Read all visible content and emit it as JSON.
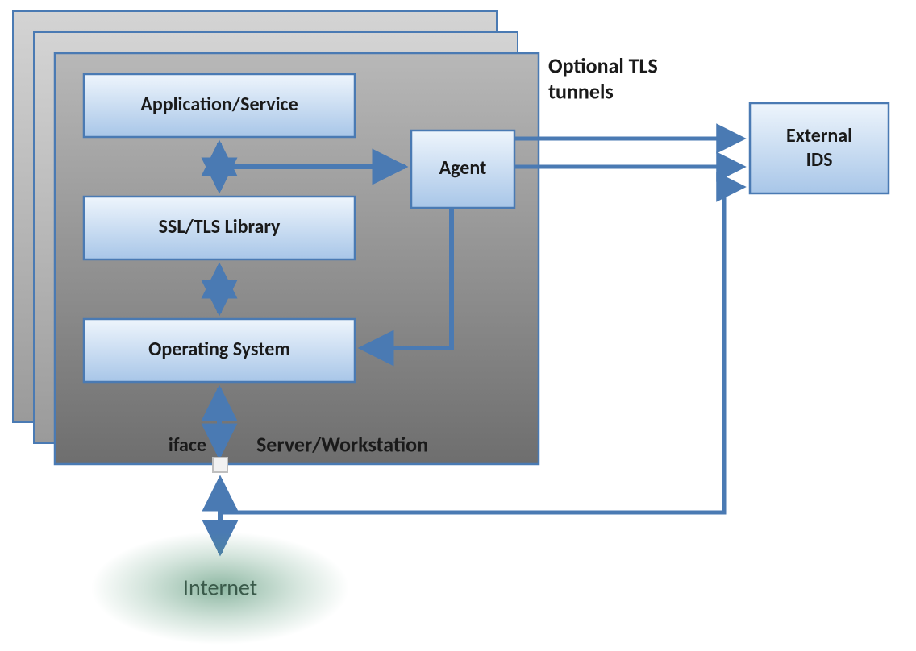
{
  "boxes": {
    "application": "Application/Service",
    "ssltls": "SSL/TLS Library",
    "os": "Operating System",
    "agent": "Agent",
    "external_ids_l1": "External",
    "external_ids_l2": "IDS"
  },
  "labels": {
    "optional_l1": "Optional TLS",
    "optional_l2": "tunnels",
    "server_workstation": "Server/Workstation",
    "iface": "iface",
    "internet": "Internet"
  },
  "colors": {
    "panel_stroke": "#4a7ab3",
    "panel_fill_top": "#a9a9a9",
    "panel_fill_bottom": "#7a7a7a",
    "box_stroke": "#4a7ab3",
    "box_fill_top": "#eaf1fb",
    "box_fill_bottom": "#b5cfec",
    "arrow": "#4a7ab3",
    "internet_glow": "#5a9a7a"
  }
}
